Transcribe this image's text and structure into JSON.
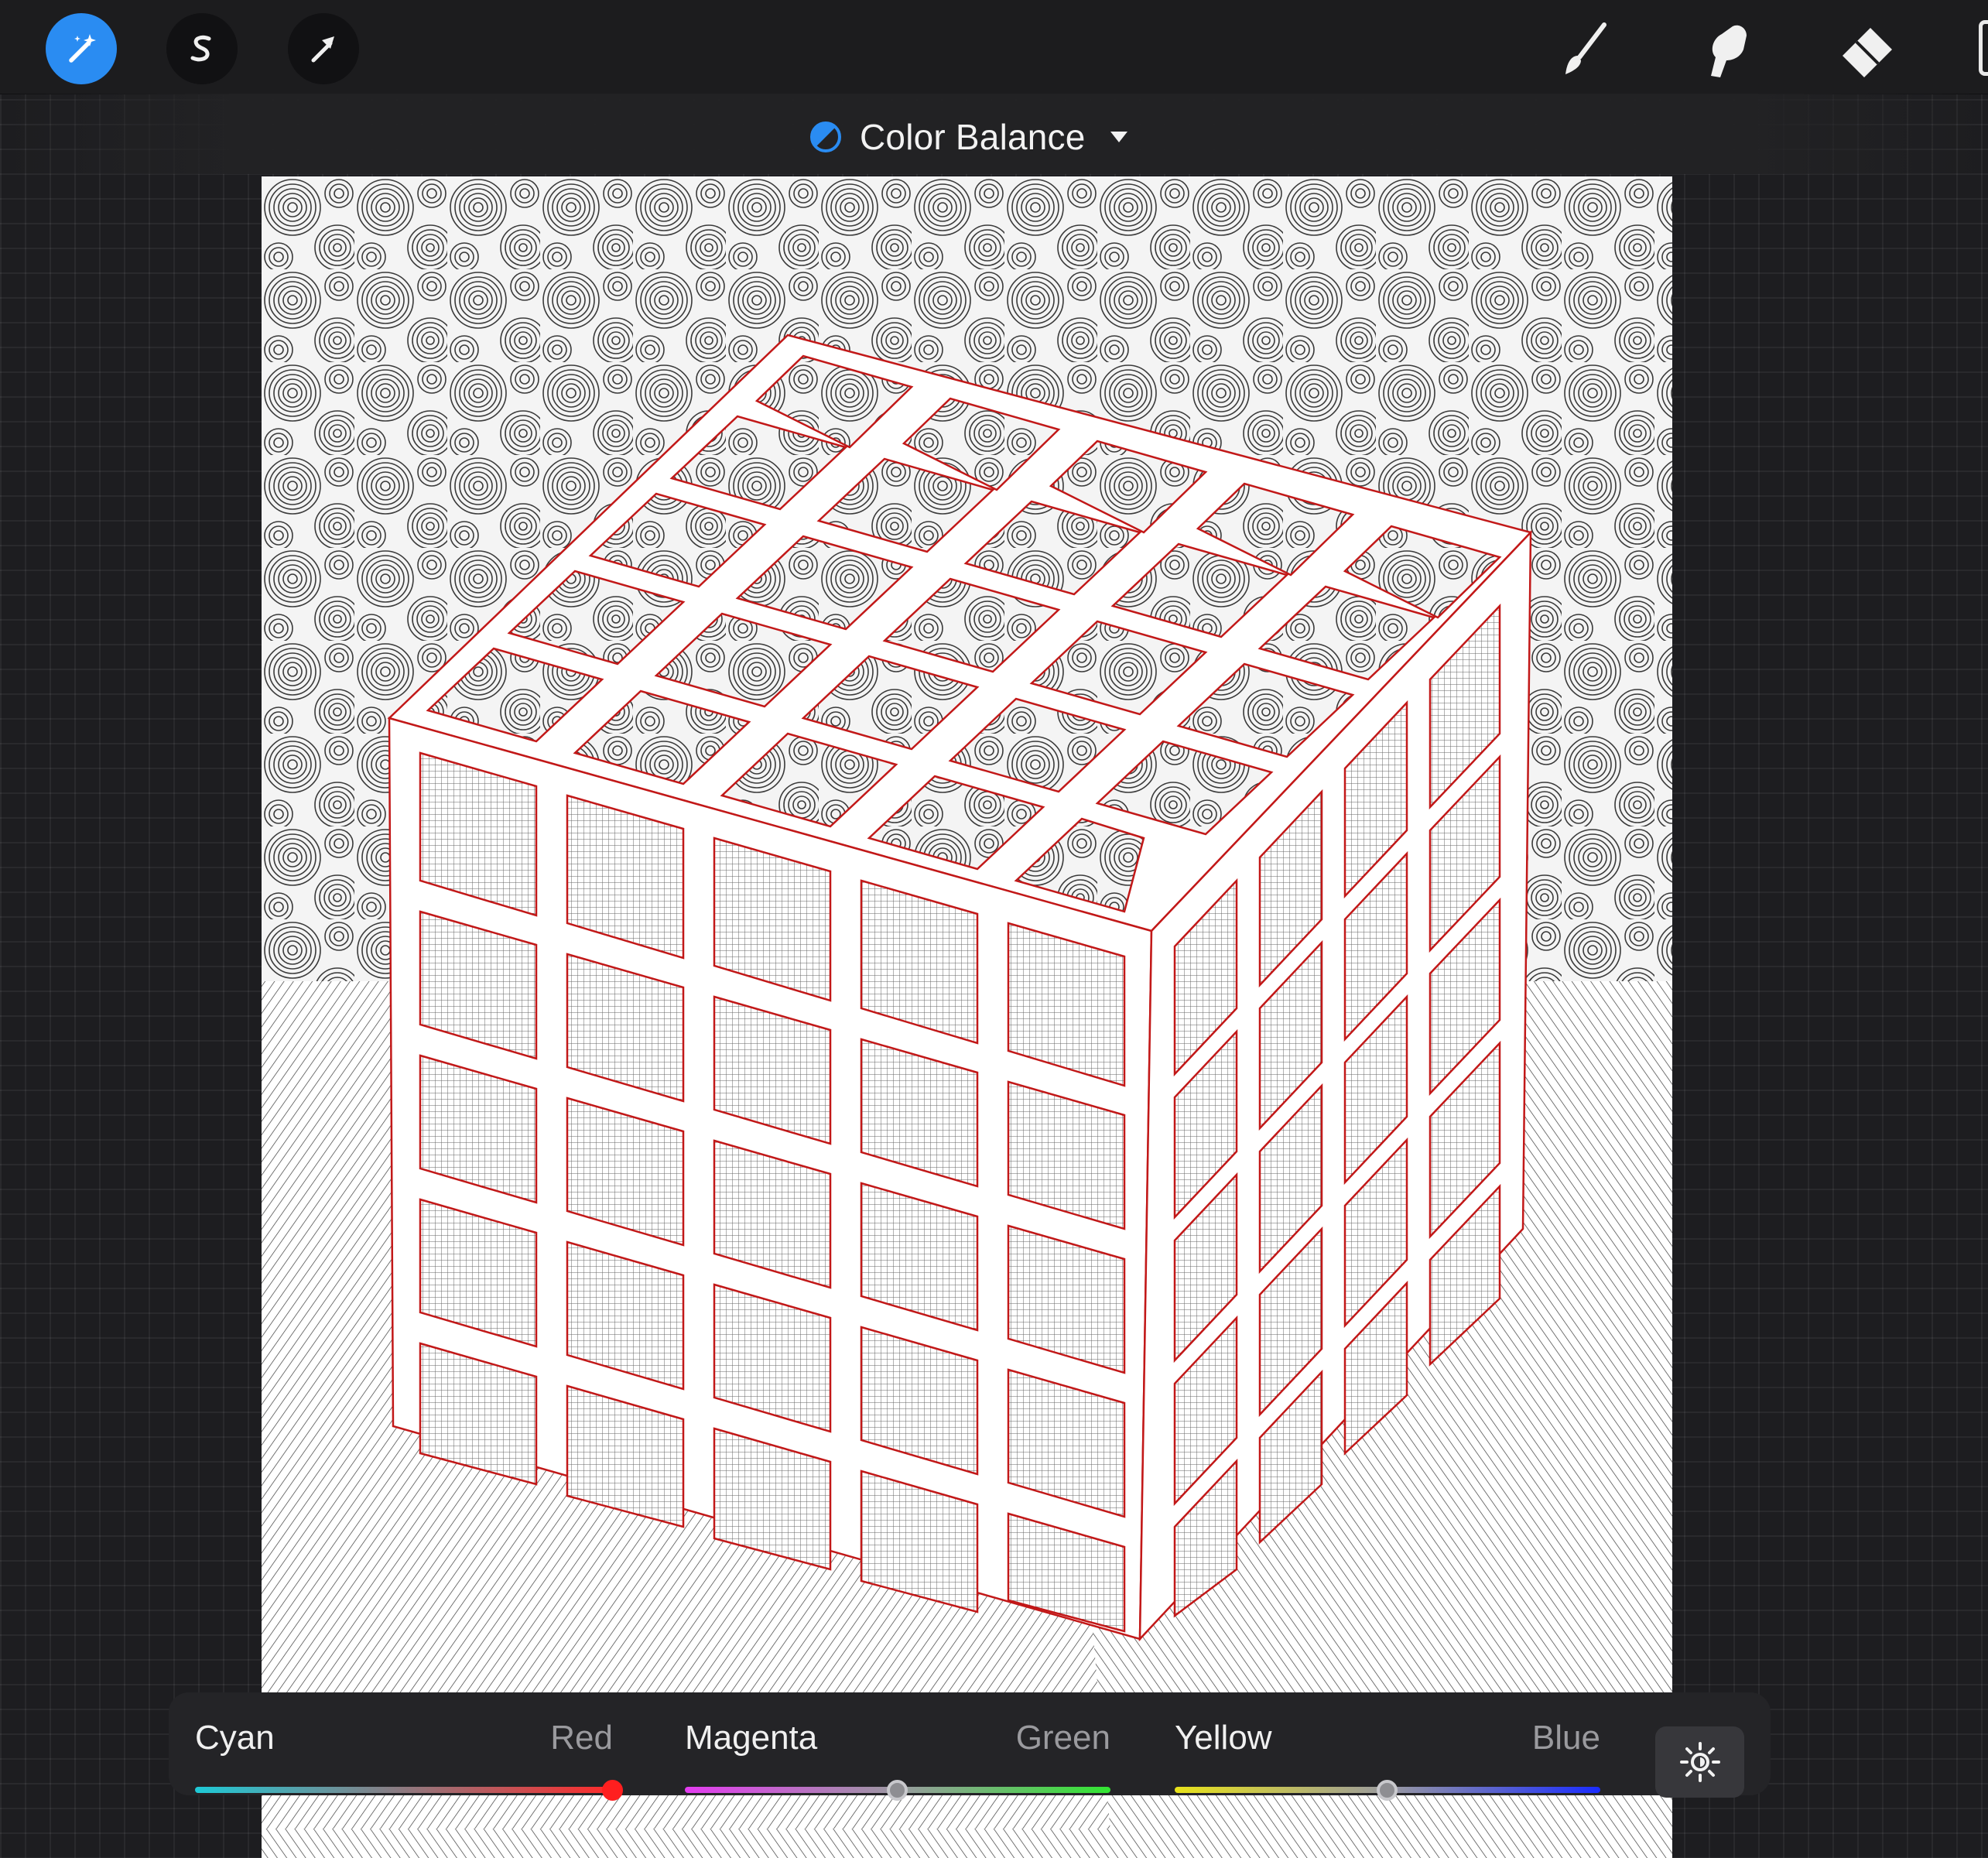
{
  "app": {
    "top_toolbar": {
      "left_tools": [
        {
          "name": "adjustments-icon",
          "active": true
        },
        {
          "name": "selection-icon",
          "active": false
        },
        {
          "name": "transform-icon",
          "active": false
        }
      ],
      "right_tools": [
        "brush-icon",
        "smudge-icon",
        "eraser-icon"
      ]
    },
    "adjustment": {
      "title": "Color Balance",
      "icon": "color-balance-icon",
      "dropdown_icon": "caret-down-icon"
    }
  },
  "color_balance": {
    "sliders": [
      {
        "left_label": "Cyan",
        "right_label": "Red",
        "value": 1.0,
        "gradient": [
          "#1ec9d6",
          "#ff2a2a"
        ],
        "thumb_color": "#ff1f1f"
      },
      {
        "left_label": "Magenta",
        "right_label": "Green",
        "value": 0.5,
        "gradient": [
          "#e33cf0",
          "#32e632"
        ],
        "thumb_color": "#8e8e92"
      },
      {
        "left_label": "Yellow",
        "right_label": "Blue",
        "value": 0.5,
        "gradient": [
          "#e8e21a",
          "#1a2cff"
        ],
        "thumb_color": "#8e8e92"
      }
    ],
    "brightness_toggle_icon": "brightness-icon"
  },
  "colors": {
    "accent": "#2a8cf2",
    "toolbar_bg": "#1c1c1e",
    "artwork_line": "#c21818"
  }
}
